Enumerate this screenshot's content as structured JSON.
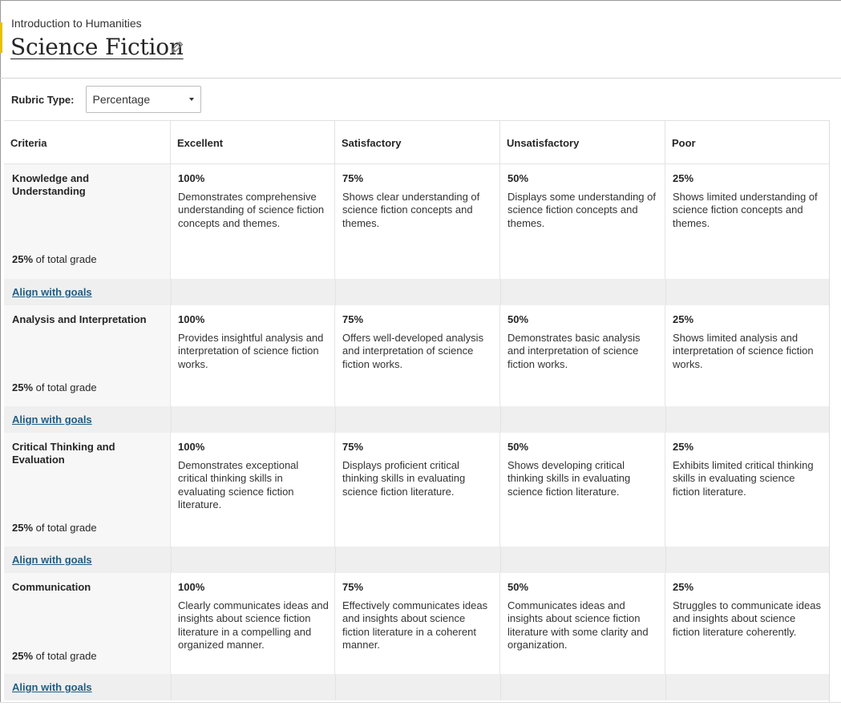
{
  "header": {
    "course": "Introduction to Humanities",
    "title": "Science Fiction"
  },
  "rubric": {
    "label": "Rubric Type:",
    "selected": "Percentage"
  },
  "columns": [
    "Criteria",
    "Excellent",
    "Satisfactory",
    "Unsatisfactory",
    "Poor"
  ],
  "weight_suffix": "of total grade",
  "goal_link_label": "Align with goals",
  "criteria": [
    {
      "name": "Knowledge and Understanding",
      "weight": "25%",
      "levels": [
        {
          "pct": "100%",
          "desc": "Demonstrates comprehensive understanding of science fiction concepts and themes."
        },
        {
          "pct": "75%",
          "desc": "Shows clear understanding of science fiction concepts and themes."
        },
        {
          "pct": "50%",
          "desc": "Displays some understanding of science fiction concepts and themes."
        },
        {
          "pct": "25%",
          "desc": "Shows limited understanding of science fiction concepts and themes."
        }
      ]
    },
    {
      "name": "Analysis and Interpretation",
      "weight": "25%",
      "levels": [
        {
          "pct": "100%",
          "desc": "Provides insightful analysis and interpretation of science fiction works."
        },
        {
          "pct": "75%",
          "desc": "Offers well-developed analysis and interpretation of science fiction works."
        },
        {
          "pct": "50%",
          "desc": "Demonstrates basic analysis and interpretation of science fiction works."
        },
        {
          "pct": "25%",
          "desc": "Shows limited analysis and interpretation of science fiction works."
        }
      ]
    },
    {
      "name": "Critical Thinking and Evaluation",
      "weight": "25%",
      "levels": [
        {
          "pct": "100%",
          "desc": "Demonstrates exceptional critical thinking skills in evaluating science fiction literature."
        },
        {
          "pct": "75%",
          "desc": "Displays proficient critical thinking skills in evaluating science fiction literature."
        },
        {
          "pct": "50%",
          "desc": "Shows developing critical thinking skills in evaluating science fiction literature."
        },
        {
          "pct": "25%",
          "desc": "Exhibits limited critical thinking skills in evaluating science fiction literature."
        }
      ]
    },
    {
      "name": "Communication",
      "weight": "25%",
      "levels": [
        {
          "pct": "100%",
          "desc": "Clearly communicates ideas and insights about science fiction literature in a compelling and organized manner."
        },
        {
          "pct": "75%",
          "desc": "Effectively communicates ideas and insights about science fiction literature in a coherent manner."
        },
        {
          "pct": "50%",
          "desc": "Communicates ideas and insights about science fiction literature with some clarity and organization."
        },
        {
          "pct": "25%",
          "desc": "Struggles to communicate ideas and insights about science fiction literature coherently."
        }
      ]
    }
  ],
  "colors": {
    "link": "#1f5e86",
    "accent": "#e5c100",
    "goal_row_bg": "#efefef",
    "criteria_bg": "#f7f7f7"
  },
  "icons": {
    "edit": "pencil-icon",
    "dropdown": "chevron-down-icon"
  }
}
